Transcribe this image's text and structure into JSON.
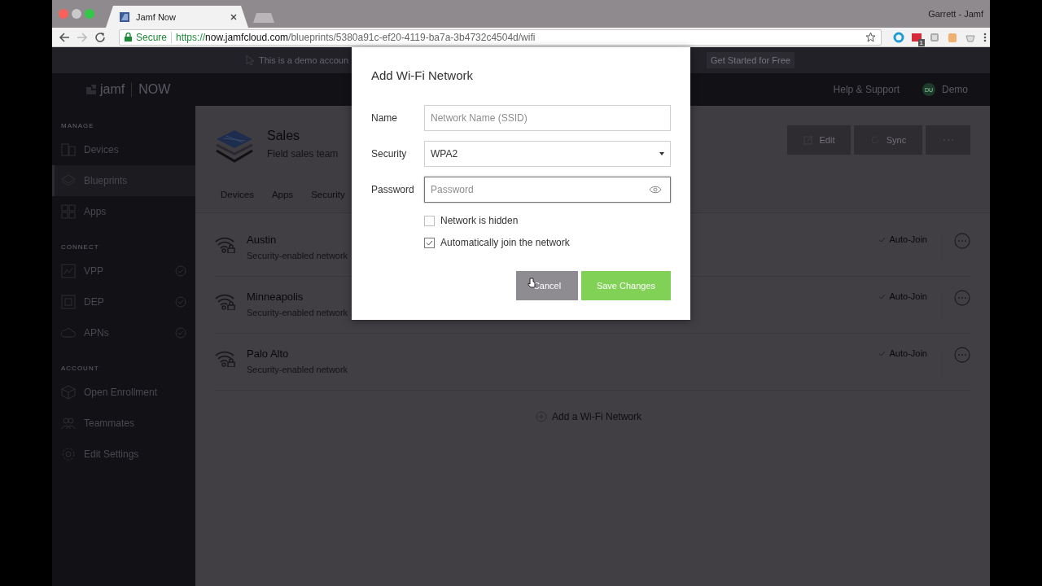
{
  "browser": {
    "tab_title": "Jamf Now",
    "profile": "Garrett - Jamf",
    "security_label": "Secure",
    "url_scheme": "https://",
    "url_host": "now.jamfcloud.com",
    "url_path": "/blueprints/5380a91c-ef20-4119-ba7a-3b4732c4504d/wifi",
    "extension_badge": "1"
  },
  "banner": {
    "text": "This is a demo accoun",
    "button": "Get Started for Free"
  },
  "header": {
    "logo_word": "jamf",
    "logo_suffix": "NOW",
    "help": "Help & Support",
    "avatar": "DU",
    "user": "Demo"
  },
  "sidebar": {
    "sections": [
      {
        "heading": "MANAGE",
        "items": [
          {
            "label": "Devices",
            "selected": false,
            "connected": false
          },
          {
            "label": "Blueprints",
            "selected": true,
            "connected": false
          },
          {
            "label": "Apps",
            "selected": false,
            "connected": false
          }
        ]
      },
      {
        "heading": "CONNECT",
        "items": [
          {
            "label": "VPP",
            "selected": false,
            "connected": true
          },
          {
            "label": "DEP",
            "selected": false,
            "connected": true
          },
          {
            "label": "APNs",
            "selected": false,
            "connected": true
          }
        ]
      },
      {
        "heading": "ACCOUNT",
        "items": [
          {
            "label": "Open Enrollment",
            "selected": false,
            "connected": false
          },
          {
            "label": "Teammates",
            "selected": false,
            "connected": false
          },
          {
            "label": "Edit Settings",
            "selected": false,
            "connected": false
          }
        ]
      }
    ]
  },
  "blueprint": {
    "title": "Sales",
    "subtitle": "Field sales team",
    "actions": [
      {
        "kind": "edit",
        "label": "Edit"
      },
      {
        "kind": "sync",
        "label": "Sync"
      },
      {
        "kind": "more"
      }
    ],
    "tabs": [
      "Devices",
      "Apps",
      "Security"
    ]
  },
  "networks": [
    {
      "name": "Austin",
      "subtitle": "Security-enabled network",
      "auto_join": "Auto-Join"
    },
    {
      "name": "Minneapolis",
      "subtitle": "Security-enabled network",
      "auto_join": "Auto-Join"
    },
    {
      "name": "Palo Alto",
      "subtitle": "Security-enabled network",
      "auto_join": "Auto-Join"
    }
  ],
  "add_network": "Add a Wi-Fi Network",
  "modal": {
    "title": "Add Wi-Fi Network",
    "fields": [
      {
        "kind": "text",
        "label": "Name",
        "placeholder": "Network Name (SSID)",
        "focused": false
      },
      {
        "kind": "select",
        "label": "Security",
        "value": "WPA2",
        "focused": false
      },
      {
        "kind": "password",
        "label": "Password",
        "placeholder": "Password",
        "focused": true
      }
    ],
    "checkboxes": [
      {
        "label": "Network is hidden",
        "checked": false
      },
      {
        "label": "Automatically join the network",
        "checked": true
      }
    ],
    "buttons": [
      {
        "kind": "secondary",
        "label": "Cancel"
      },
      {
        "kind": "primary",
        "label": "Save Changes"
      }
    ]
  }
}
